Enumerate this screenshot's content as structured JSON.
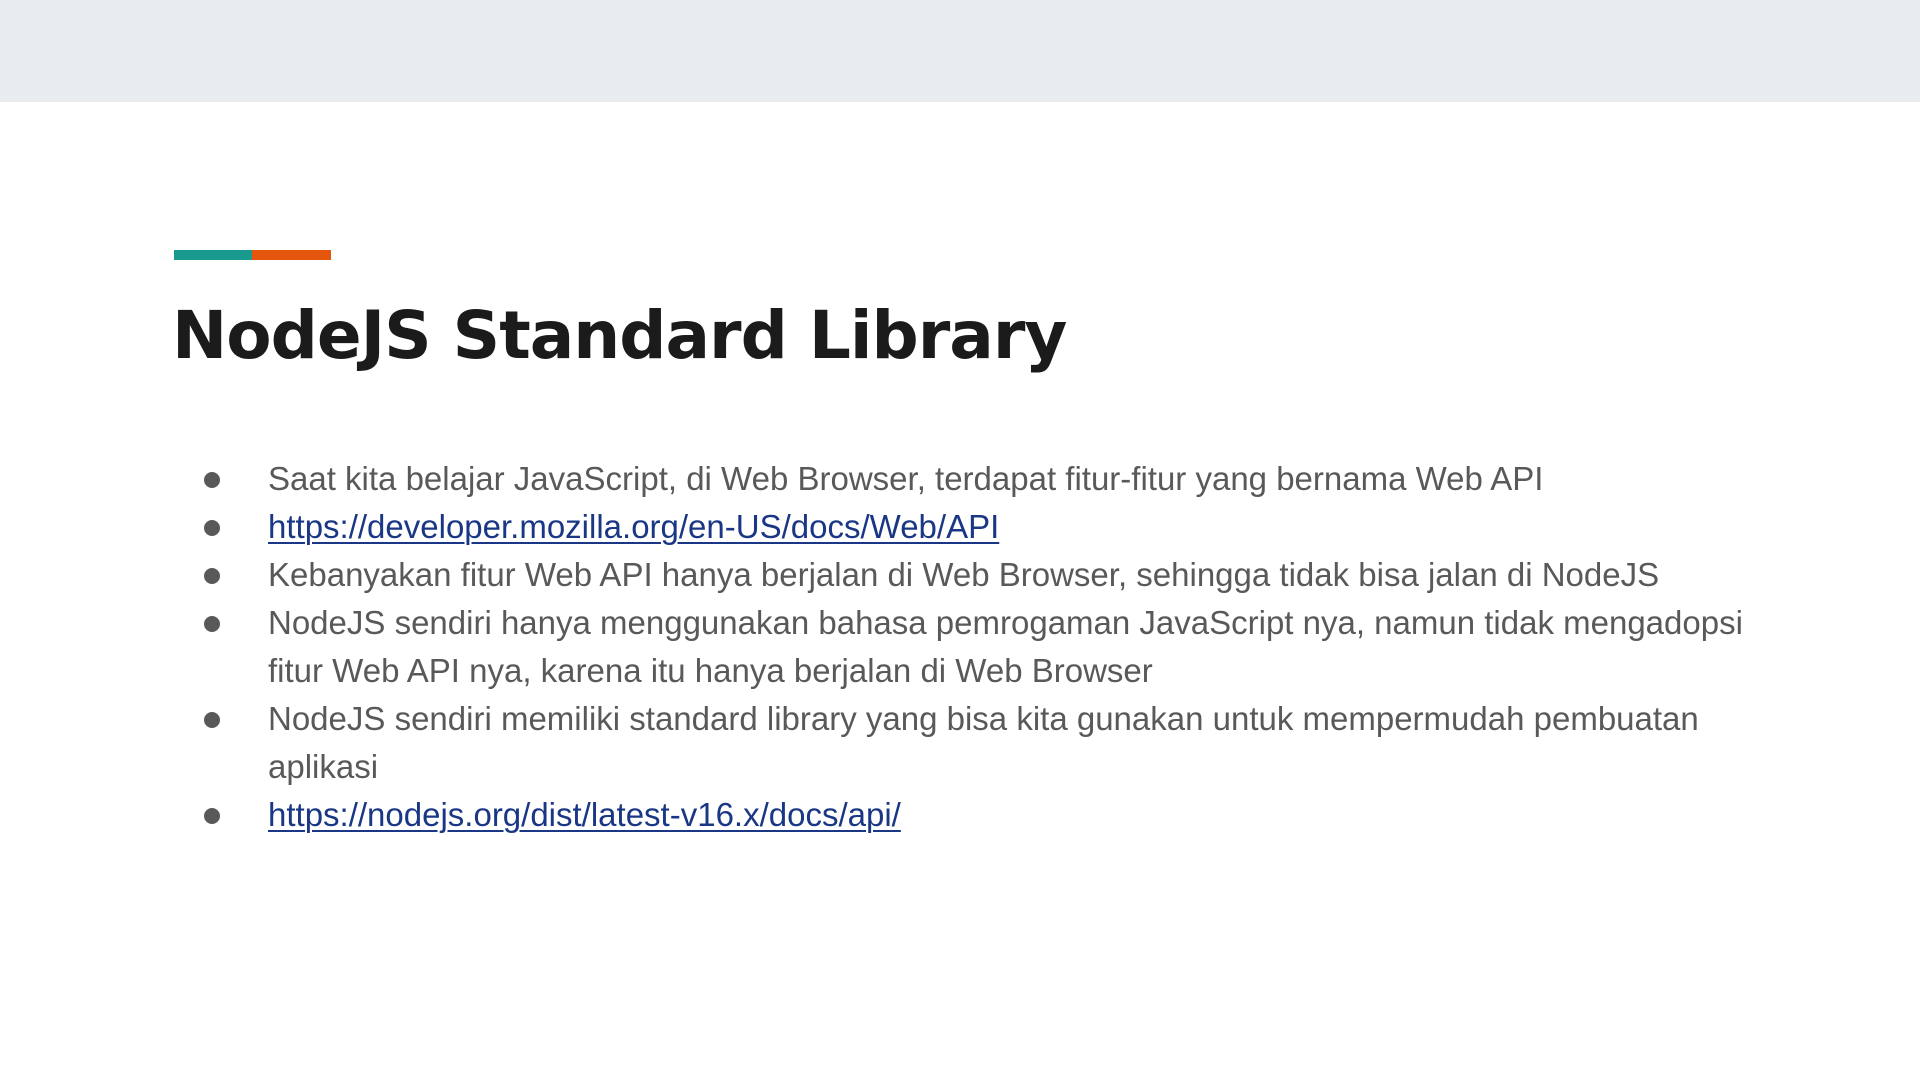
{
  "slide": {
    "accent_colors": [
      "#199a8e",
      "#e4550e"
    ],
    "title": "NodeJS Standard Library",
    "bullets": [
      {
        "text": "Saat kita belajar JavaScript, di Web Browser, terdapat fitur-fitur yang bernama Web API",
        "is_link": false
      },
      {
        "text": "https://developer.mozilla.org/en-US/docs/Web/API",
        "is_link": true
      },
      {
        "text": "Kebanyakan fitur Web API hanya berjalan di Web Browser, sehingga tidak bisa jalan di NodeJS",
        "is_link": false
      },
      {
        "text": "NodeJS sendiri hanya menggunakan bahasa pemrogaman JavaScript nya, namun tidak mengadopsi fitur Web API nya, karena itu hanya berjalan di Web Browser",
        "is_link": false
      },
      {
        "text": "NodeJS sendiri memiliki standard library yang bisa kita gunakan untuk mempermudah pembuatan aplikasi",
        "is_link": false
      },
      {
        "text": "https://nodejs.org/dist/latest-v16.x/docs/api/",
        "is_link": true
      }
    ]
  }
}
